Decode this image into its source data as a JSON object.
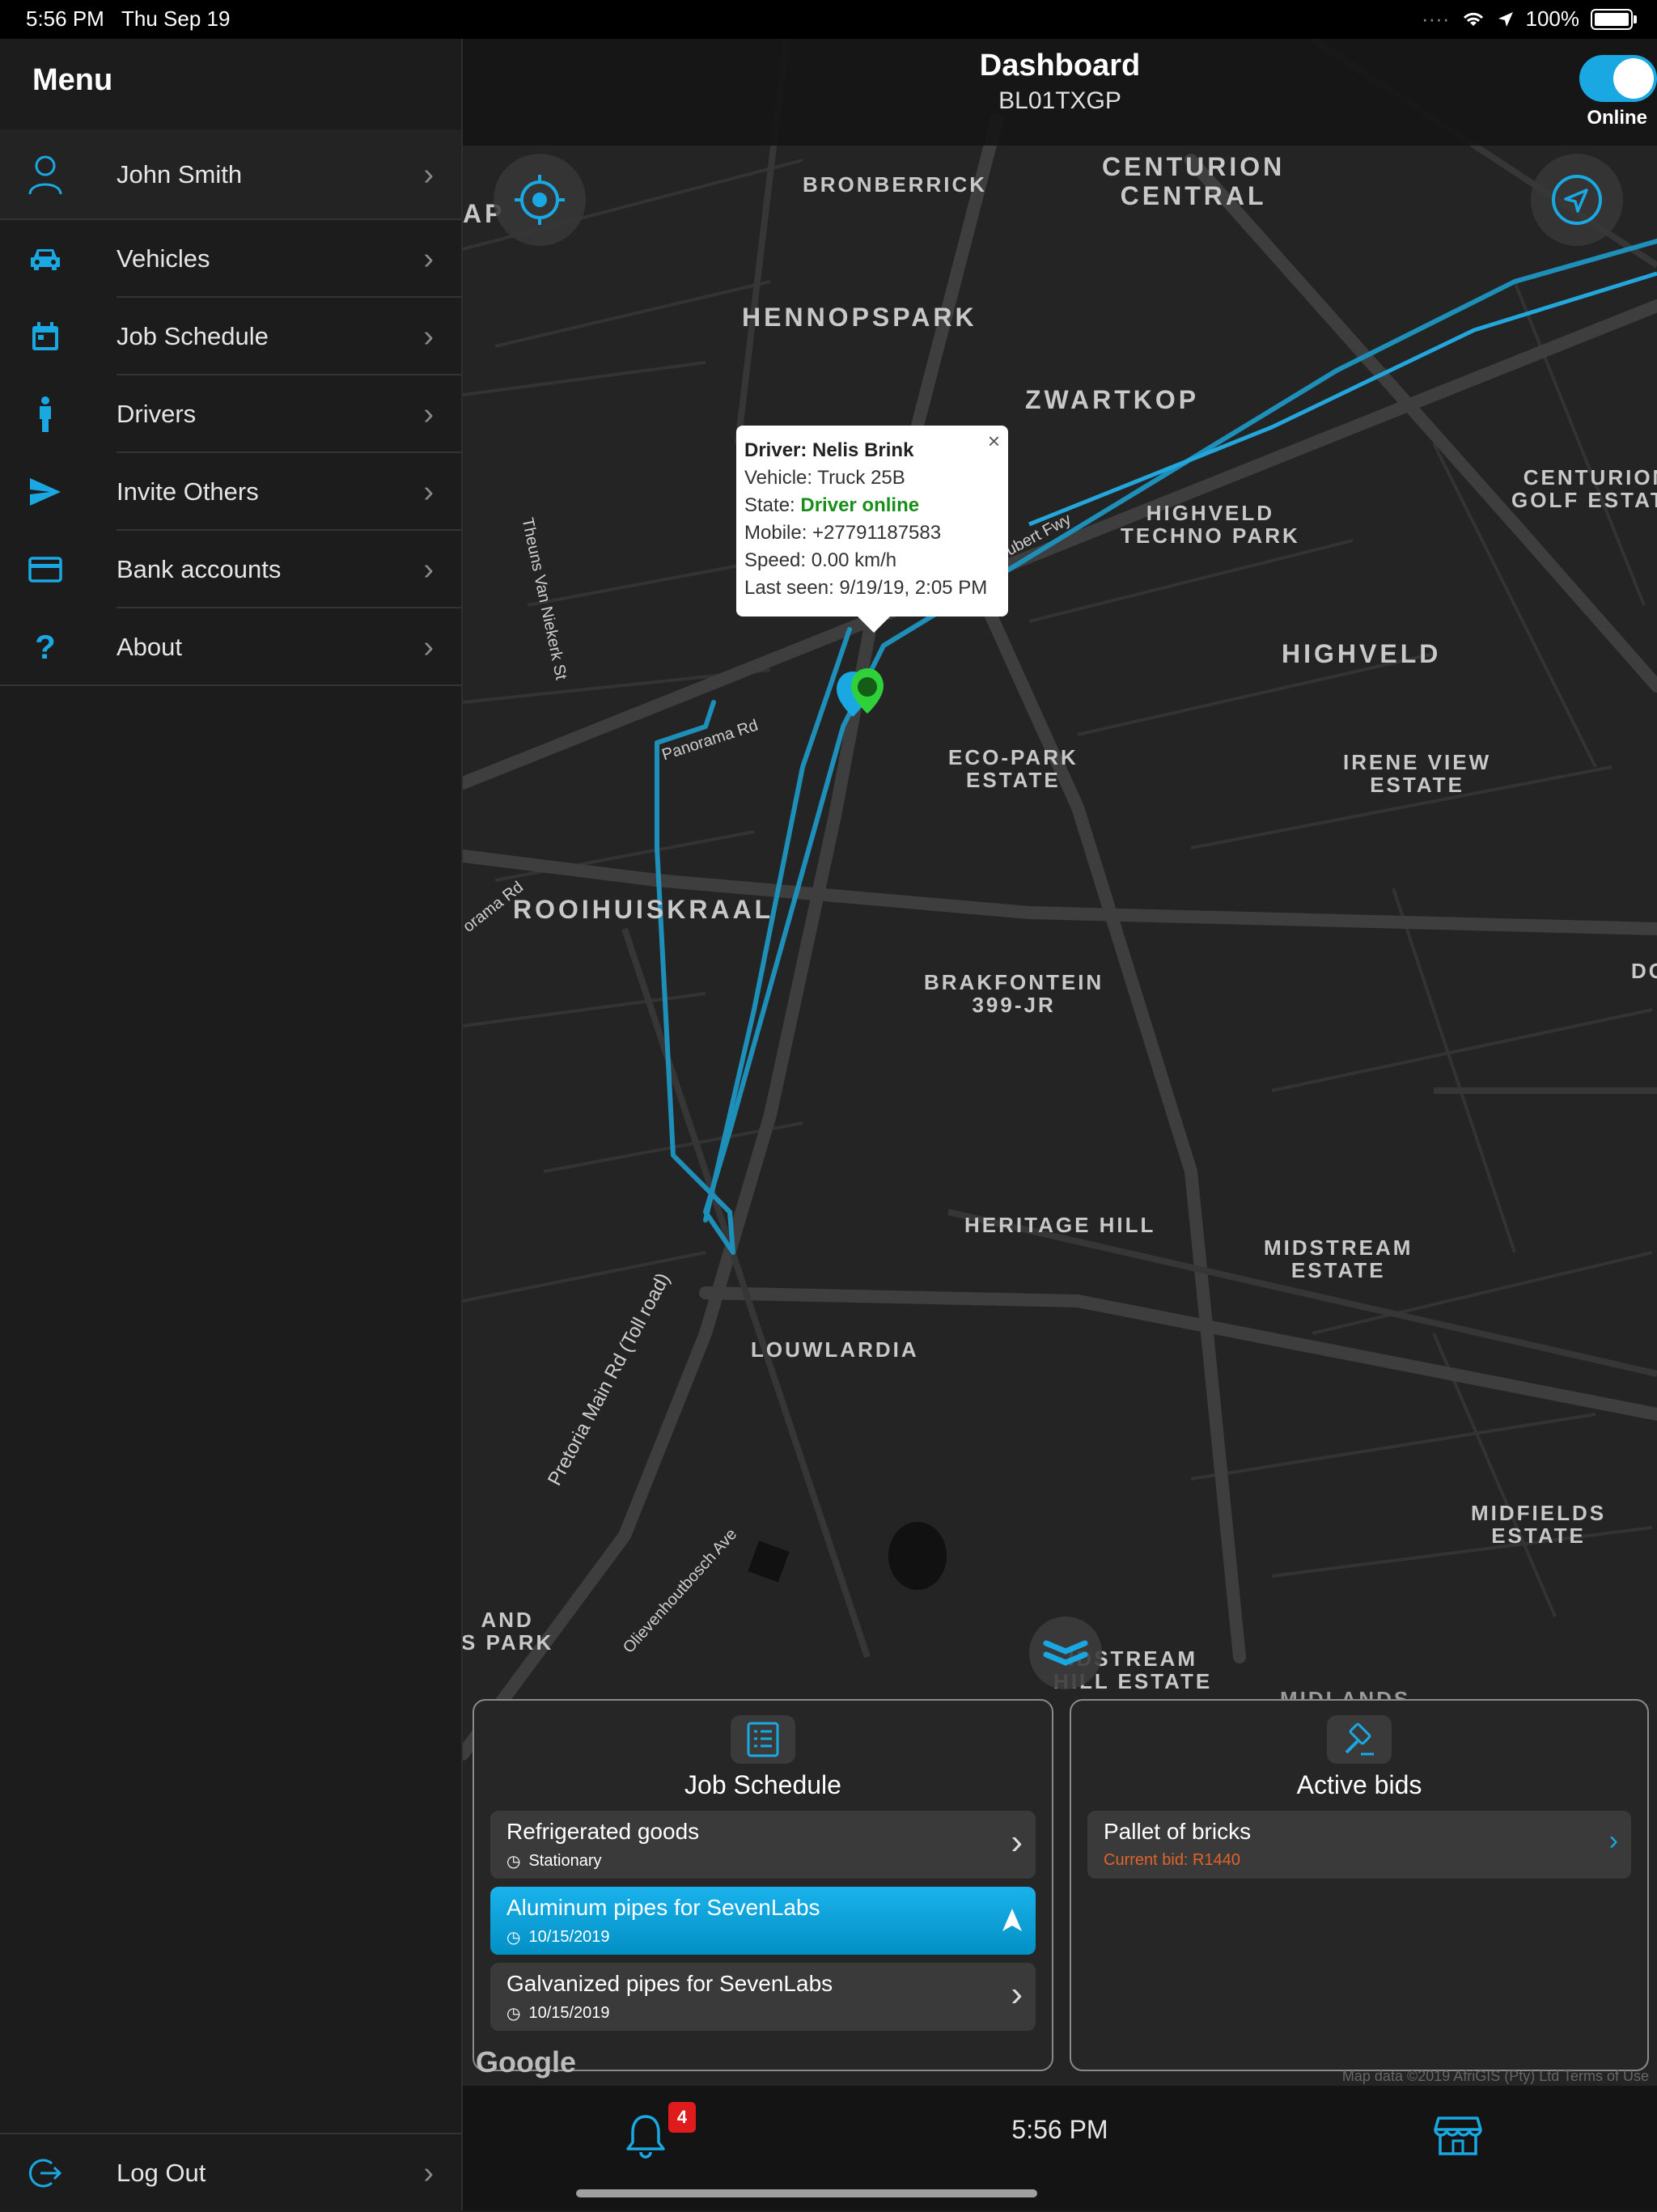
{
  "status_bar": {
    "time": "5:56 PM",
    "date": "Thu Sep 19",
    "battery": "100%"
  },
  "sidebar": {
    "title": "Menu",
    "user": "John Smith",
    "items": [
      {
        "label": "Vehicles",
        "icon": "car-icon"
      },
      {
        "label": "Job Schedule",
        "icon": "calendar-icon"
      },
      {
        "label": "Drivers",
        "icon": "person-icon"
      },
      {
        "label": "Invite Others",
        "icon": "send-icon"
      },
      {
        "label": "Bank accounts",
        "icon": "credit-card-icon"
      },
      {
        "label": "About",
        "icon": "question-icon"
      }
    ],
    "logout": "Log Out"
  },
  "header": {
    "title": "Dashboard",
    "subtitle": "BL01TXGP",
    "toggle_label": "Online"
  },
  "map_labels": {
    "bronberrick": "BRONBERRICK",
    "centurion_central": "CENTURION\nCENTRAL",
    "hennopspark": "HENNOPSPARK",
    "zwartkop": "ZWARTKOP",
    "centurion_golf": "CENTURION\nGOLF ESTATE",
    "highveld_techno": "HIGHVELD\nTECHNO PARK",
    "highveld": "HIGHVELD",
    "eco_park": "ECO-PARK\nESTATE",
    "irene_view": "IRENE VIEW\nESTATE",
    "rooihuiskraal": "ROOIHUISKRAAL",
    "brakfontein": "BRAKFONTEIN\n399-JR",
    "heritage_hill": "HERITAGE HILL",
    "midstream_estate": "MIDSTREAM\nESTATE",
    "louwlardia": "LOUWLARDIA",
    "midfields": "MIDFIELDS\nESTATE",
    "midstream_hill": "IDSTREAM\nHILL ESTATE",
    "and_park": "AND\nS PARK",
    "apark": "AP",
    "do": "DO",
    "midlands": "MIDLANDS",
    "road_panorama": "Panorama Rd",
    "road_panorama2": "orama Rd",
    "road_theuns": "Theuns Van Niekerk St",
    "road_pretoria": "Pretoria Main Rd (Toll road)",
    "road_olievenhoutbosch": "Olievenhoutbosch Ave",
    "road_fwy": "ubert Fwy",
    "google": "Google",
    "map_data": "Map data ©2019 AfriGIS (Pty) Ltd    Terms of Use"
  },
  "popup": {
    "driver_label": "Driver: Nelis Brink",
    "vehicle": "Vehicle: Truck 25B",
    "state_prefix": "State: ",
    "state_value": "Driver online",
    "mobile": "Mobile: +27791187583",
    "speed": "Speed: 0.00 km/h",
    "last_seen": "Last seen: 9/19/19, 2:05 PM",
    "close": "×"
  },
  "job_schedule": {
    "title": "Job Schedule",
    "jobs": [
      {
        "name": "Refrigerated goods",
        "meta": "Stationary"
      },
      {
        "name": "Aluminum pipes for SevenLabs",
        "meta": "10/15/2019"
      },
      {
        "name": "Galvanized pipes for SevenLabs",
        "meta": "10/15/2019"
      }
    ]
  },
  "active_bids": {
    "title": "Active bids",
    "bids": [
      {
        "name": "Pallet of bricks",
        "meta": "Current bid: R1440"
      }
    ]
  },
  "bottom_bar": {
    "clock": "5:56 PM",
    "notification_count": "4"
  },
  "colors": {
    "accent": "#1aa8e3",
    "route": "#1e8fb8",
    "bid": "#e0632a",
    "online": "#1a8e1a",
    "marker_green": "#2fd13a"
  }
}
